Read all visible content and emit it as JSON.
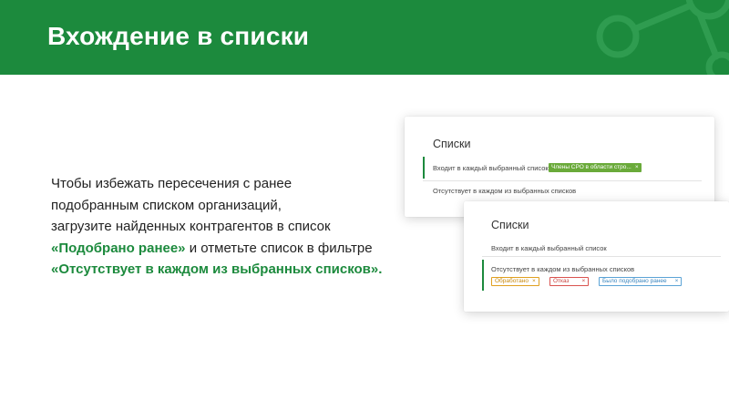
{
  "header": {
    "title": "Вхождение в списки"
  },
  "body": {
    "line1": "Чтобы избежать пересечения с ранее",
    "line2": "подобранным списком организаций,",
    "line3": "загрузите найденных контрагентов в список",
    "highlight1": "«Подобрано ранее»",
    "line4_rest": " и отметьте список в фильтре",
    "highlight2": "«Отсутствует в каждом из выбранных списков»."
  },
  "card1": {
    "title": "Списки",
    "row1_label": "Входит в каждый выбранный список",
    "tag": "Члены СРО в области стро...",
    "row2_label": "Отсутствует в каждом из выбранных списков"
  },
  "card2": {
    "title": "Списки",
    "row1_label": "Входит в каждый выбранный список",
    "row2_label": "Отсутствует в каждом из выбранных списков",
    "tags": [
      {
        "label": "Обработано",
        "color": "#e0a020"
      },
      {
        "label": "Отказ",
        "color": "#d9534f"
      },
      {
        "label": "Было подобрано ранее",
        "color": "#5ba3d6"
      }
    ]
  },
  "icons": {
    "remove": "×"
  },
  "colors": {
    "brand_green": "#1c8a3d",
    "tag_green": "#6aaa3a"
  }
}
